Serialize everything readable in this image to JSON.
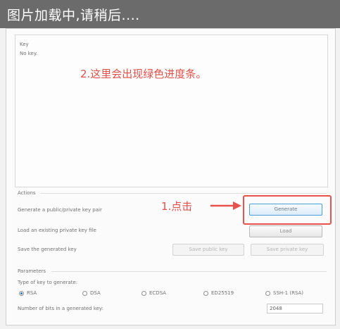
{
  "overlay": {
    "loading_text": "图片加载中,请稍后...."
  },
  "key_panel": {
    "heading": "Key",
    "status": "No key."
  },
  "annotations": {
    "note_top": "2.这里会出现绿色进度条。",
    "note_click": "1.点击",
    "arrow_color": "#e8524c",
    "highlight_color": "#e8524c"
  },
  "actions": {
    "heading": "Actions",
    "generate_label": "Generate a public/private key pair",
    "generate_button": "Generate",
    "load_label": "Load an existing private key file",
    "load_button": "Load",
    "save_label": "Save the generated key",
    "save_public_button": "Save public key",
    "save_private_button": "Save private key"
  },
  "parameters": {
    "heading": "Parameters",
    "type_label": "Type of key to generate:",
    "key_types": [
      {
        "label": "RSA",
        "selected": true
      },
      {
        "label": "DSA",
        "selected": false
      },
      {
        "label": "ECDSA",
        "selected": false
      },
      {
        "label": "ED25519",
        "selected": false
      },
      {
        "label": "SSH-1 (RSA)",
        "selected": false
      }
    ],
    "bits_label": "Number of bits in a generated key:",
    "bits_value": "2048"
  }
}
